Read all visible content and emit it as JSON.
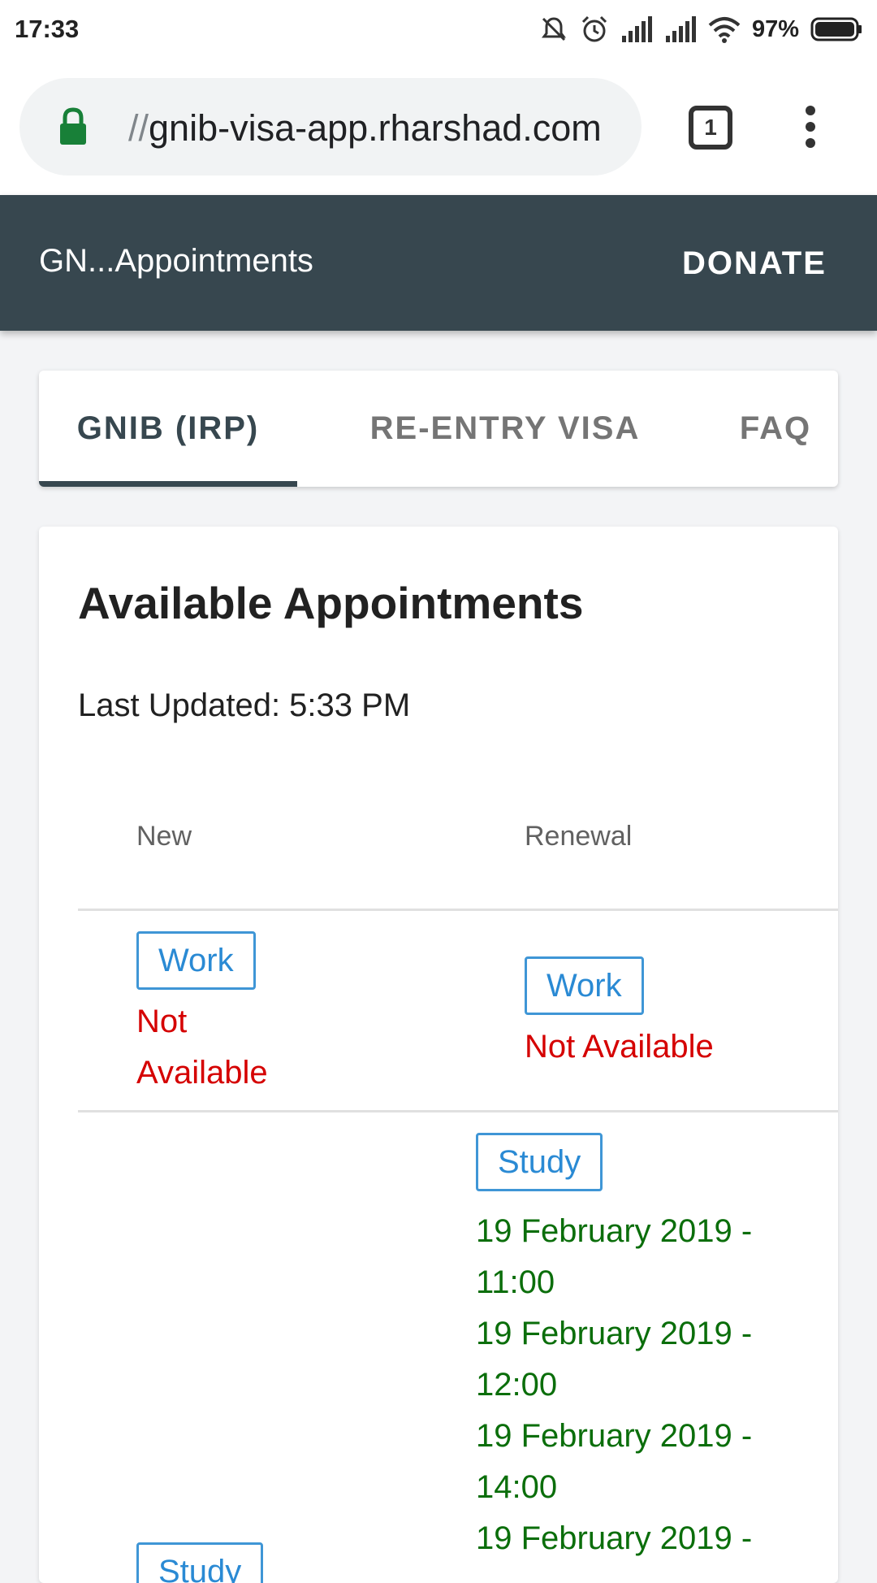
{
  "status_bar": {
    "time": "17:33",
    "battery": "97%",
    "icons": [
      "mute-icon",
      "alarm-icon",
      "signal-icon",
      "signal-icon",
      "wifi-icon",
      "battery-icon"
    ]
  },
  "browser": {
    "url_scheme": "//",
    "url_host": "gnib-visa-app.rharshad.com",
    "tab_count": "1"
  },
  "app_bar": {
    "title": "GN...Appointments",
    "donate_label": "DONATE",
    "color": "#37474f"
  },
  "tabs": [
    {
      "label": "GNIB (IRP)",
      "active": true
    },
    {
      "label": "RE-ENTRY VISA",
      "active": false
    },
    {
      "label": "FAQ",
      "active": false
    }
  ],
  "card": {
    "title": "Available Appointments",
    "last_updated": "Last Updated: 5:33 PM",
    "columns": [
      "New",
      "Renewal"
    ],
    "rows": [
      {
        "new": {
          "category": "Work",
          "status_line1": "Not",
          "status_line2": "Available"
        },
        "renewal": {
          "category": "Work",
          "status": "Not Available"
        }
      },
      {
        "new": {
          "category": "Study",
          "status": ""
        },
        "renewal": {
          "category": "Study",
          "slots": [
            {
              "line1": "19 February 2019 -",
              "line2": "11:00"
            },
            {
              "line1": "19 February 2019 -",
              "line2": "12:00"
            },
            {
              "line1": "19 February 2019 -",
              "line2": "14:00"
            },
            {
              "line1": "19 February 2019 -",
              "line2": ""
            }
          ]
        }
      }
    ]
  },
  "colors": {
    "available": "#0b6e0b",
    "not_available": "#d50000",
    "chip": "#2a8ad4"
  }
}
